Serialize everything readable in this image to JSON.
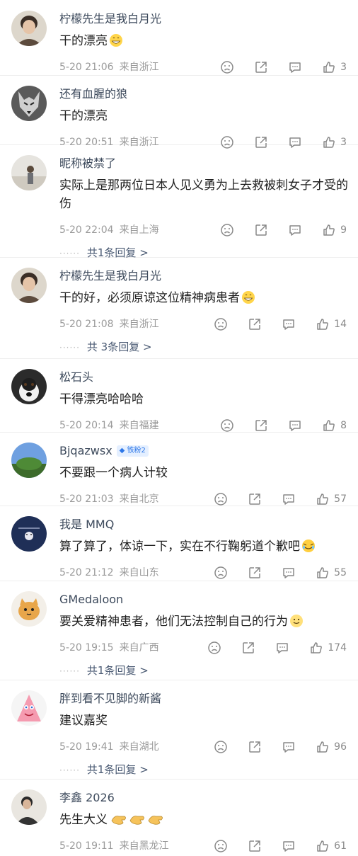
{
  "comments": [
    {
      "username": "柠檬先生是我白月光",
      "text": "干的漂亮",
      "date": "5-20 21:06",
      "location": "来自浙江",
      "likes": "3"
    },
    {
      "username": "还有血腥的狼",
      "text": "干的漂亮",
      "date": "5-20 20:51",
      "location": "来自浙江",
      "likes": "3"
    },
    {
      "username": "昵称被禁了",
      "text": "实际上是那两位日本人见义勇为上去救被刺女子才受的伤",
      "date": "5-20 22:04",
      "location": "来自上海",
      "likes": "9",
      "replies": "共1条回复 >"
    },
    {
      "username": "柠檬先生是我白月光",
      "text": "干的好，必须原谅这位精神病患者",
      "date": "5-20 21:08",
      "location": "来自浙江",
      "likes": "14",
      "replies": "共 3条回复 >"
    },
    {
      "username": "松石头",
      "text": "干得漂亮哈哈哈",
      "date": "5-20 20:14",
      "location": "来自福建",
      "likes": "8"
    },
    {
      "username": "Bjqazwsx",
      "badge": "铁粉2",
      "text": "不要跟一个病人计较",
      "date": "5-20 21:03",
      "location": "来自北京",
      "likes": "57"
    },
    {
      "username": "我是 MMQ",
      "text": "算了算了，体谅一下，实在不行鞠躬道个歉吧",
      "date": "5-20 21:12",
      "location": "来自山东",
      "likes": "55"
    },
    {
      "username": "GMedaloon",
      "text": "要关爱精神患者，他们无法控制自己的行为",
      "date": "5-20 19:15",
      "location": "来自广西",
      "likes": "174",
      "replies": "共1条回复 >"
    },
    {
      "username": "胖到看不见脚的新酱",
      "text": "建议嘉奖",
      "date": "5-20 19:41",
      "location": "来自湖北",
      "likes": "96",
      "replies": "共1条回复 >"
    },
    {
      "username": "李鑫 2026",
      "text": "先生大义",
      "date": "5-20 19:11",
      "location": "来自黑龙江",
      "likes": "61"
    }
  ],
  "replies_dots": "······"
}
